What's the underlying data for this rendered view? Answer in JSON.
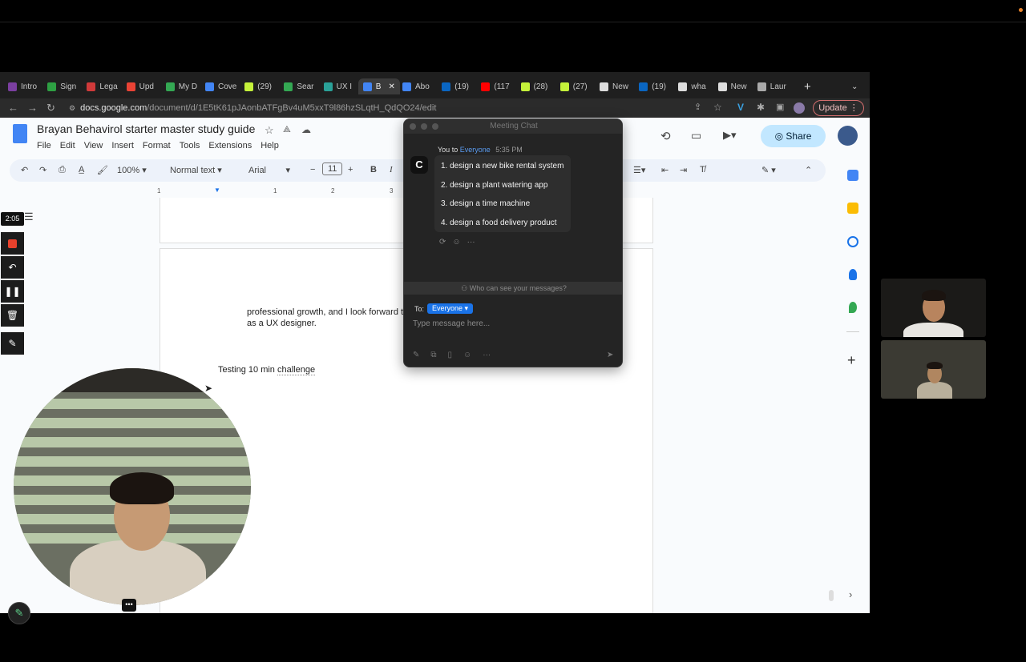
{
  "browser": {
    "tabs": [
      {
        "label": "Intro",
        "favicon_color": "#7b3fa0"
      },
      {
        "label": "Sign",
        "favicon_color": "#2ea043"
      },
      {
        "label": "Lega",
        "favicon_color": "#d03a3a"
      },
      {
        "label": "Upd",
        "favicon_color": "#ea4335"
      },
      {
        "label": "My D",
        "favicon_color": "#34a853"
      },
      {
        "label": "Cove",
        "favicon_color": "#4285f4"
      },
      {
        "label": "(29)",
        "favicon_color": "#c5f23a"
      },
      {
        "label": "Sear",
        "favicon_color": "#34a853"
      },
      {
        "label": "UX I",
        "favicon_color": "#2aa198"
      },
      {
        "label": "B",
        "favicon_color": "#4285f4"
      },
      {
        "label": "Abo",
        "favicon_color": "#4285f4"
      },
      {
        "label": "(19)",
        "favicon_color": "#0a66c2"
      },
      {
        "label": "(117",
        "favicon_color": "#ff0000"
      },
      {
        "label": "(28)",
        "favicon_color": "#c5f23a"
      },
      {
        "label": "(27)",
        "favicon_color": "#c5f23a"
      },
      {
        "label": "New",
        "favicon_color": "#dddddd"
      },
      {
        "label": "(19)",
        "favicon_color": "#0a66c2"
      },
      {
        "label": "wha",
        "favicon_color": "#dddddd"
      },
      {
        "label": "New",
        "favicon_color": "#dddddd"
      },
      {
        "label": "Laur",
        "favicon_color": "#aaaaaa"
      }
    ],
    "new_tab": "+",
    "url_host": "docs.google.com",
    "url_path": "/document/d/1E5tK61pJAonbATFgBv4uM5xxT9l86hzSLqtH_QdQO24/edit",
    "update_label": "Update"
  },
  "docs": {
    "title": "Brayan Behavirol starter master study guide",
    "menu": [
      "File",
      "Edit",
      "View",
      "Insert",
      "Format",
      "Tools",
      "Extensions",
      "Help"
    ],
    "zoom": "100%",
    "style": "Normal text",
    "font": "Arial",
    "font_size": "11",
    "share_label": "Share",
    "ruler_marks": [
      "1",
      "1",
      "2",
      "3"
    ],
    "body_line_1": "professional growth, and I look forward t",
    "body_line_2": "as a UX designer.",
    "testing_prefix": "Testing 10 min ",
    "testing_word": "challenge"
  },
  "chat": {
    "window_title": "Meeting Chat",
    "avatar_letter": "C",
    "sender": "You to",
    "recipient": "Everyone",
    "time": "5:35 PM",
    "messages": [
      "1. design a new bike rental system",
      "2. design a plant watering app",
      "3. design a time machine",
      "4. design a food delivery product"
    ],
    "privacy_text": "Who can see your messages?",
    "to_label": "To:",
    "to_value": "Everyone",
    "input_placeholder": "Type message here..."
  },
  "recorder": {
    "timer": "2:05"
  },
  "accent_colors": {
    "docs_blue": "#1a73e8",
    "record_red": "#e8412c",
    "update_border": "#d36e6e"
  }
}
